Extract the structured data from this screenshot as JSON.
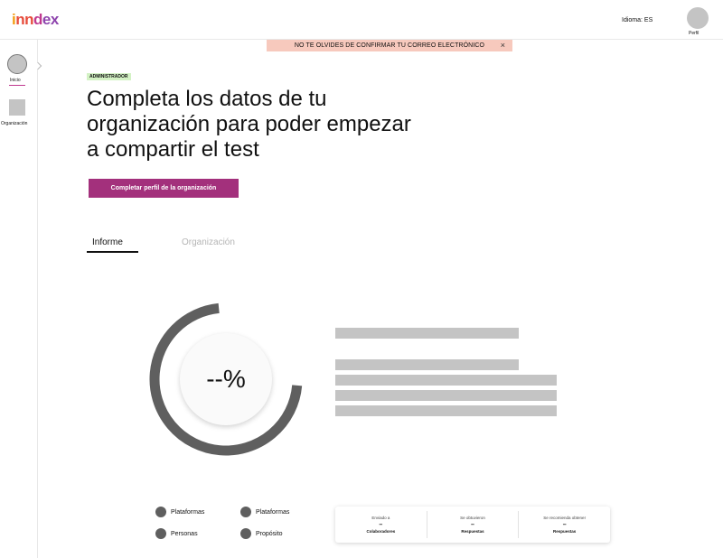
{
  "brand": {
    "logo_parts": [
      "i",
      "nn",
      "d",
      "ex"
    ]
  },
  "header": {
    "language_label": "Idioma: ES",
    "profile_label": "Perfil"
  },
  "notice": {
    "text": "NO TE OLVIDES DE CONFIRMAR TU CORREO ELECTRÓNICO",
    "close": "×"
  },
  "sidebar": {
    "items": [
      {
        "label": "Inicio"
      },
      {
        "label": "Organización"
      }
    ]
  },
  "main": {
    "role_badge": "ADMINISTRADOR",
    "headline": "Completa los datos de tu organización para poder empezar a compartir el test",
    "cta_label": "Completar perfil de la organización",
    "tabs": [
      {
        "label": "Informe",
        "active": true
      },
      {
        "label": "Organización",
        "active": false
      }
    ]
  },
  "report": {
    "donut_value": "--%",
    "donut_progress": 0.72,
    "colors": {
      "accent": "#a3307c",
      "donut": "#5f5f5f",
      "placeholder": "#c4c4c4",
      "notice": "#f7c9bd",
      "badge": "#d3f2c4"
    },
    "legend": [
      "Plataformas",
      "Plataformas",
      "Personas",
      "Propósito"
    ],
    "stats": [
      {
        "caption": "Enviado a",
        "value": "–",
        "unit": "Colaboradores"
      },
      {
        "caption": "Se obtuvieron",
        "value": "–",
        "unit": "Respuestas"
      },
      {
        "caption": "Se recomienda obtener",
        "value": "–",
        "unit": "Respuestas"
      }
    ]
  }
}
